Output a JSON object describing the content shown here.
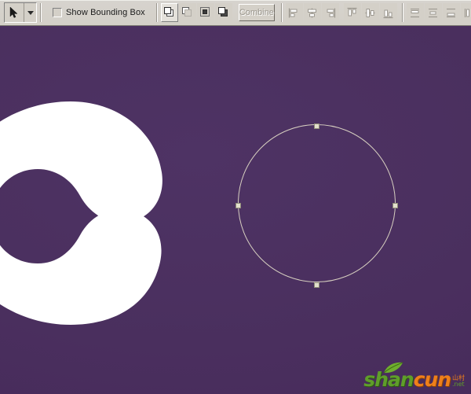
{
  "app": {
    "background_color": "#4a2f5e",
    "canvas_label": "artboard"
  },
  "toolbar": {
    "drag_handle": "toolbar-grip",
    "selection_tool": {
      "label": "Selection Tool",
      "icon": "cursor-arrow-icon",
      "state": "active"
    },
    "tool_dropdown": {
      "label": "Tool options",
      "icon": "chevron-down-icon"
    },
    "show_bounding_box": {
      "label": "Show Bounding Box",
      "checked": false
    },
    "pathfinder": {
      "buttons": [
        {
          "label": "Unite",
          "icon": "shape-unite-icon",
          "state": "active"
        },
        {
          "label": "Subtract",
          "icon": "shape-subtract-icon",
          "state": "normal"
        },
        {
          "label": "Intersect",
          "icon": "shape-intersect-icon",
          "state": "normal"
        },
        {
          "label": "Exclude",
          "icon": "shape-exclude-icon",
          "state": "normal"
        }
      ]
    },
    "combine": {
      "label": "Combine",
      "enabled": false
    },
    "align_horizontal": {
      "buttons": [
        {
          "label": "Align Left",
          "icon": "align-left-icon",
          "enabled": false
        },
        {
          "label": "Align Horizontal Center",
          "icon": "align-center-icon",
          "enabled": false
        },
        {
          "label": "Align Right",
          "icon": "align-right-icon",
          "enabled": false
        }
      ]
    },
    "align_vertical": {
      "buttons": [
        {
          "label": "Align Top",
          "icon": "align-top-icon",
          "enabled": false
        },
        {
          "label": "Align Vertical Center",
          "icon": "align-middle-icon",
          "enabled": false
        },
        {
          "label": "Align Bottom",
          "icon": "align-bottom-icon",
          "enabled": false
        }
      ]
    },
    "distribute": {
      "buttons": [
        {
          "label": "Distribute Top Edges",
          "icon": "distribute-top-icon",
          "enabled": false
        },
        {
          "label": "Distribute Vertical Centers",
          "icon": "distribute-middle-icon",
          "enabled": false
        },
        {
          "label": "Distribute Bottom Edges",
          "icon": "distribute-bottom-icon",
          "enabled": false
        },
        {
          "label": "Distribute Left Edges",
          "icon": "distribute-left-icon",
          "enabled": false
        }
      ]
    }
  },
  "canvas": {
    "letter_shape": {
      "name": "letter-c-shape",
      "fill": "#ffffff"
    },
    "ellipse": {
      "name": "ellipse-path",
      "stroke": "#d7cfc0",
      "selected": true,
      "handles": [
        "top",
        "right",
        "bottom",
        "left"
      ]
    }
  },
  "watermark": {
    "part_one": "shan",
    "part_two": "cun",
    "chinese": "山村",
    "domain": ".net",
    "color_green": "#5f9e2a",
    "color_orange": "#ef7f1a"
  }
}
